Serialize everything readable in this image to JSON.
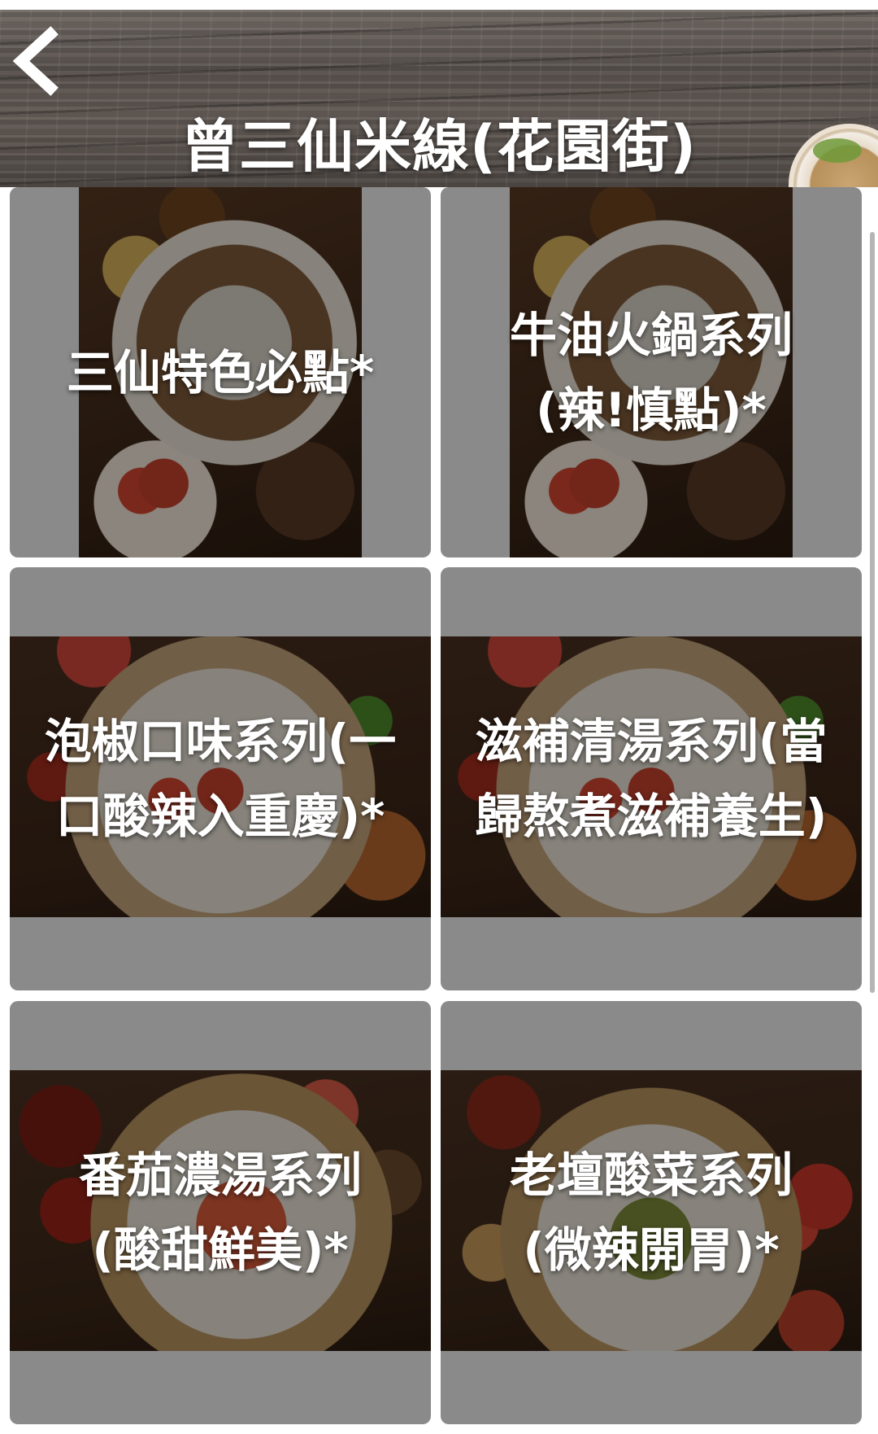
{
  "header": {
    "title": "曾三仙米線(花園街)",
    "back_icon": "chevron-left-icon"
  },
  "categories": [
    {
      "label": "三仙特色必點*",
      "image": "food-a"
    },
    {
      "label": "牛油火鍋系列(辣!慎點)*",
      "image": "food-a"
    },
    {
      "label": "泡椒口味系列(一口酸辣入重慶)*",
      "image": "food-b"
    },
    {
      "label": "滋補清湯系列(當歸熬煮滋補養生)",
      "image": "food-b"
    },
    {
      "label": "番茄濃湯系列(酸甜鮮美)*",
      "image": "food-c"
    },
    {
      "label": "老壇酸菜系列(微辣開胃)*",
      "image": "food-d"
    }
  ],
  "colors": {
    "card_bg": "#8a8a8a",
    "text": "#ffffff"
  }
}
